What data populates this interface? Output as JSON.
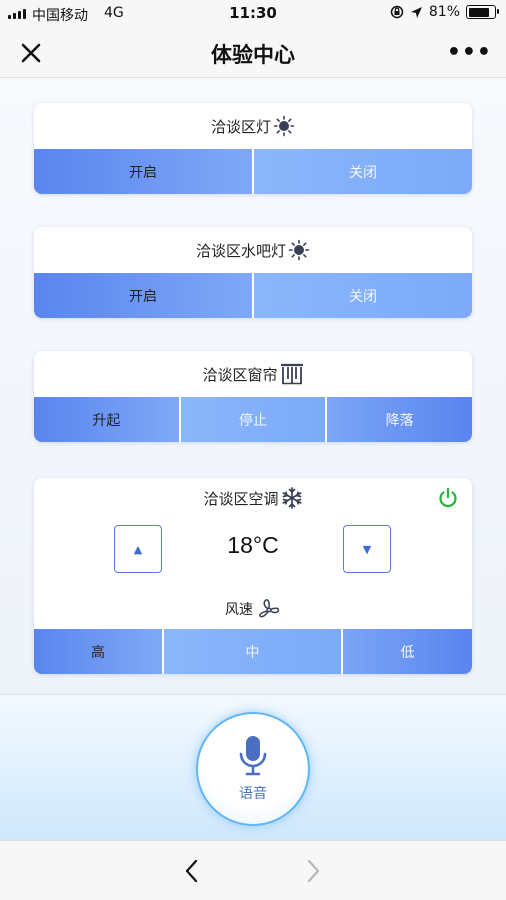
{
  "status_bar": {
    "carrier": "中国移动",
    "network": "4G",
    "time": "11:30",
    "battery": "81%"
  },
  "nav": {
    "title": "体验中心",
    "more": "•••"
  },
  "cards": {
    "light": {
      "title": "洽谈区灯",
      "on": "开启",
      "off": "关闭"
    },
    "bar_light": {
      "title": "洽谈区水吧灯",
      "on": "开启",
      "off": "关闭"
    },
    "curtain": {
      "title": "洽谈区窗帘",
      "up": "升起",
      "stop": "停止",
      "down": "降落"
    },
    "ac": {
      "title": "洽谈区空调",
      "temperature": "18°C",
      "up_arrow": "▲",
      "down_arrow": "▼",
      "fan_label": "风速",
      "high": "高",
      "mid": "中",
      "low": "低"
    }
  },
  "voice": {
    "label": "语音"
  },
  "colors": {
    "accent": "#5a85ee",
    "button_light": "#8ab6fb",
    "power_green": "#27b33a",
    "voice_ring": "#5fb6f3"
  },
  "icons": [
    "close-icon",
    "more-icon",
    "sun-icon",
    "curtain-icon",
    "snowflake-icon",
    "power-icon",
    "fan-icon",
    "microphone-icon",
    "chevron-left-icon",
    "chevron-right-icon"
  ]
}
